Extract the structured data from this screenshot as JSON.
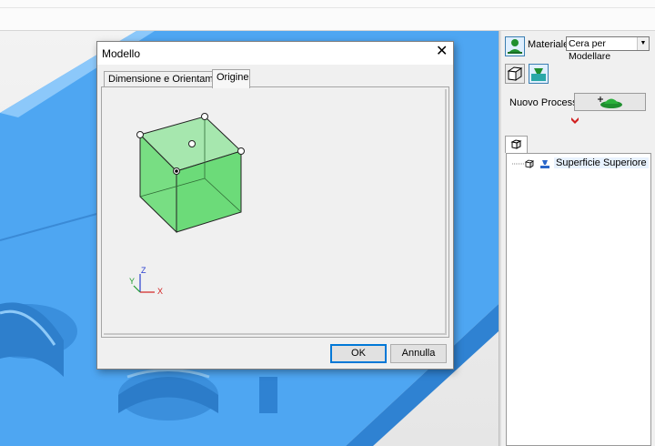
{
  "dialog": {
    "title": "Modello",
    "close_glyph": "✕",
    "tabs": [
      {
        "label": "Dimensione e Orientamento",
        "active": false
      },
      {
        "label": "Origine",
        "active": true
      }
    ],
    "axes": {
      "x": "X",
      "y": "Y",
      "z": "Z"
    },
    "ok_label": "OK",
    "cancel_label": "Annulla"
  },
  "right_panel": {
    "material_label": "Materiale",
    "material_value": "Cera per Modellare",
    "new_process_label": "Nuovo Processo",
    "tree_items": [
      {
        "label": "Superficie Superiore"
      }
    ]
  },
  "icons": {
    "material": "person-icon",
    "model_view": "cube-icon",
    "tool_view": "tool-holder-icon",
    "new_process": "mill-add-icon",
    "flow_arrow": "down-arrow-icon",
    "tree_tab": "cube-icon",
    "surface": "surface-icon"
  },
  "colors": {
    "model_blue": "#4ea6f2",
    "cube_green": "#6ee07a",
    "accent_red": "#d21f1f",
    "focus_blue": "#0078d7"
  }
}
